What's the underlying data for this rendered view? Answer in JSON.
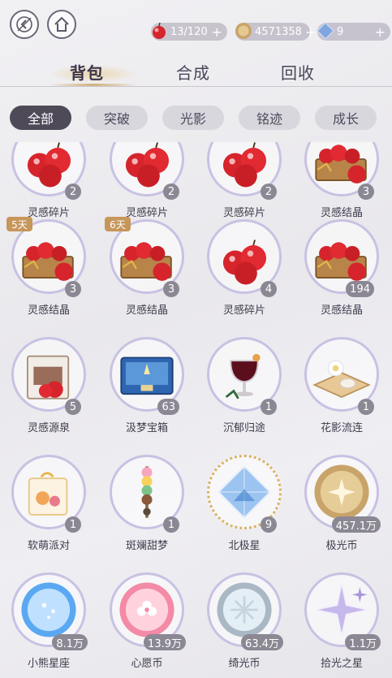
{
  "topbar": {
    "back_icon": "back-arrow-icon",
    "home_icon": "home-icon",
    "apple": {
      "icon": "apple-icon",
      "value": "13/120",
      "plus": "+"
    },
    "coin": {
      "icon": "coin-icon",
      "value": "4571358",
      "plus": "+"
    },
    "crystal": {
      "icon": "crystal-icon",
      "value": "9",
      "plus": "+"
    }
  },
  "tabs": [
    "背包",
    "合成",
    "回收"
  ],
  "filters": [
    "全部",
    "突破",
    "光影",
    "铭迹",
    "成长"
  ],
  "items": [
    {
      "name": "灵感碎片",
      "count": "2",
      "icon": "apples-icon"
    },
    {
      "name": "灵感碎片",
      "count": "2",
      "icon": "apples-icon"
    },
    {
      "name": "灵感碎片",
      "count": "2",
      "icon": "apples-icon"
    },
    {
      "name": "灵感结晶",
      "count": "3",
      "icon": "apple-crate-icon"
    },
    {
      "name": "灵感结晶",
      "count": "3",
      "icon": "apple-crate-icon",
      "tag": "5天"
    },
    {
      "name": "灵感结晶",
      "count": "3",
      "icon": "apple-crate-icon",
      "tag": "6天"
    },
    {
      "name": "灵感碎片",
      "count": "4",
      "icon": "apples-icon"
    },
    {
      "name": "灵感结晶",
      "count": "194",
      "icon": "apple-crate-icon"
    },
    {
      "name": "灵感源泉",
      "count": "5",
      "icon": "apple-box-icon"
    },
    {
      "name": "汲梦宝箱",
      "count": "63",
      "icon": "treasure-box-icon"
    },
    {
      "name": "沉郁归途",
      "count": "1",
      "icon": "wine-glass-icon"
    },
    {
      "name": "花影流连",
      "count": "1",
      "icon": "flower-tray-icon"
    },
    {
      "name": "软萌派对",
      "count": "1",
      "icon": "gift-bag-icon"
    },
    {
      "name": "斑斓甜梦",
      "count": "1",
      "icon": "candy-skewer-icon"
    },
    {
      "name": "北极星",
      "count": "9",
      "icon": "diamond-icon",
      "gold": true
    },
    {
      "name": "极光币",
      "count": "457.1万",
      "icon": "gold-coin-icon"
    },
    {
      "name": "小熊星座",
      "count": "8.1万",
      "icon": "blue-coin-icon"
    },
    {
      "name": "心愿币",
      "count": "13.9万",
      "icon": "pink-coin-icon"
    },
    {
      "name": "绮光币",
      "count": "63.4万",
      "icon": "silver-coin-icon"
    },
    {
      "name": "拾光之星",
      "count": "1.1万",
      "icon": "star-icon"
    }
  ],
  "colors": {
    "accent": "#4f4a58",
    "ring": "#c9c1e3",
    "gold": "#d7b464",
    "apple": "#d6242c"
  }
}
